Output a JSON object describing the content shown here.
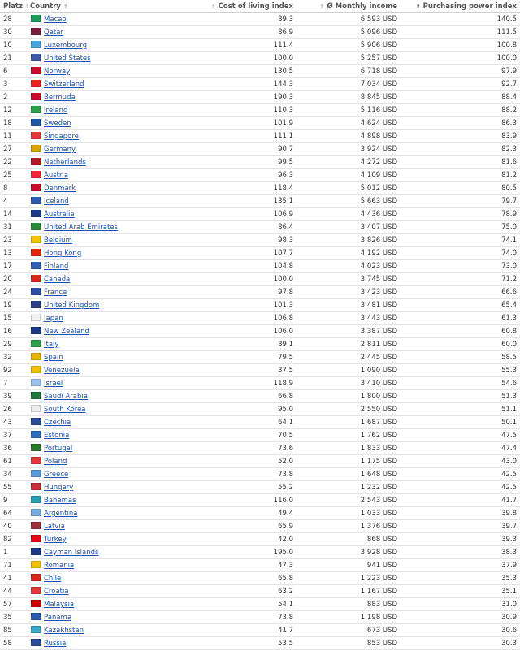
{
  "headers": {
    "rank": "Platz",
    "country": "Country",
    "cost": "Cost of living index",
    "income": "Ø Monthly income",
    "ppi": "Purchasing power index",
    "sort_icon": "⇕",
    "sort_active_icon": "⬍"
  },
  "rows": [
    {
      "rank": "28",
      "country": "Macao",
      "cost": "89.3",
      "income": "6,593 USD",
      "ppi": "140.5",
      "flag": "#1f9a5a"
    },
    {
      "rank": "30",
      "country": "Qatar",
      "cost": "86.9",
      "income": "5,096 USD",
      "ppi": "111.5",
      "flag": "#7b1e3a"
    },
    {
      "rank": "10",
      "country": "Luxembourg",
      "cost": "111.4",
      "income": "5,906 USD",
      "ppi": "100.8",
      "flag": "#4aa3df"
    },
    {
      "rank": "21",
      "country": "United States",
      "cost": "100.0",
      "income": "5,257 USD",
      "ppi": "100.0",
      "flag": "#3c5aa6"
    },
    {
      "rank": "6",
      "country": "Norway",
      "cost": "130.5",
      "income": "6,718 USD",
      "ppi": "97.9",
      "flag": "#c8102e"
    },
    {
      "rank": "3",
      "country": "Switzerland",
      "cost": "144.3",
      "income": "7,034 USD",
      "ppi": "92.7",
      "flag": "#e52521"
    },
    {
      "rank": "2",
      "country": "Bermuda",
      "cost": "190.3",
      "income": "8,845 USD",
      "ppi": "88.4",
      "flag": "#c8102e"
    },
    {
      "rank": "12",
      "country": "Ireland",
      "cost": "110.3",
      "income": "5,116 USD",
      "ppi": "88.2",
      "flag": "#2aa04a"
    },
    {
      "rank": "18",
      "country": "Sweden",
      "cost": "101.9",
      "income": "4,624 USD",
      "ppi": "86.3",
      "flag": "#1d5aa6"
    },
    {
      "rank": "11",
      "country": "Singapore",
      "cost": "111.1",
      "income": "4,898 USD",
      "ppi": "83.9",
      "flag": "#e03a3e"
    },
    {
      "rank": "27",
      "country": "Germany",
      "cost": "90.7",
      "income": "3,924 USD",
      "ppi": "82.3",
      "flag": "#d9a400"
    },
    {
      "rank": "22",
      "country": "Netherlands",
      "cost": "99.5",
      "income": "4,272 USD",
      "ppi": "81.6",
      "flag": "#ae1c28"
    },
    {
      "rank": "25",
      "country": "Austria",
      "cost": "96.3",
      "income": "4,109 USD",
      "ppi": "81.2",
      "flag": "#ed2939"
    },
    {
      "rank": "8",
      "country": "Denmark",
      "cost": "118.4",
      "income": "5,012 USD",
      "ppi": "80.5",
      "flag": "#c8102e"
    },
    {
      "rank": "4",
      "country": "Iceland",
      "cost": "135.1",
      "income": "5,663 USD",
      "ppi": "79.7",
      "flag": "#2a5db0"
    },
    {
      "rank": "14",
      "country": "Australia",
      "cost": "106.9",
      "income": "4,436 USD",
      "ppi": "78.9",
      "flag": "#1b3a8a"
    },
    {
      "rank": "31",
      "country": "United Arab Emirates",
      "cost": "86.4",
      "income": "3,407 USD",
      "ppi": "75.0",
      "flag": "#2a8a3a"
    },
    {
      "rank": "23",
      "country": "Belgium",
      "cost": "98.3",
      "income": "3,826 USD",
      "ppi": "74.1",
      "flag": "#f5c400"
    },
    {
      "rank": "13",
      "country": "Hong Kong",
      "cost": "107.7",
      "income": "4,192 USD",
      "ppi": "74.0",
      "flag": "#de2910"
    },
    {
      "rank": "17",
      "country": "Finland",
      "cost": "104.8",
      "income": "4,023 USD",
      "ppi": "73.0",
      "flag": "#2f5fb3"
    },
    {
      "rank": "20",
      "country": "Canada",
      "cost": "100.0",
      "income": "3,745 USD",
      "ppi": "71.2",
      "flag": "#d52b1e"
    },
    {
      "rank": "24",
      "country": "France",
      "cost": "97.8",
      "income": "3,423 USD",
      "ppi": "66.6",
      "flag": "#2b4fa3"
    },
    {
      "rank": "19",
      "country": "United Kingdom",
      "cost": "101.3",
      "income": "3,481 USD",
      "ppi": "65.4",
      "flag": "#2a3f86"
    },
    {
      "rank": "15",
      "country": "Japan",
      "cost": "106.8",
      "income": "3,443 USD",
      "ppi": "61.3",
      "flag": "#f2f2f2"
    },
    {
      "rank": "16",
      "country": "New Zealand",
      "cost": "106.0",
      "income": "3,387 USD",
      "ppi": "60.8",
      "flag": "#1b3a8a"
    },
    {
      "rank": "29",
      "country": "Italy",
      "cost": "89.1",
      "income": "2,811 USD",
      "ppi": "60.0",
      "flag": "#2aa04a"
    },
    {
      "rank": "32",
      "country": "Spain",
      "cost": "79.5",
      "income": "2,445 USD",
      "ppi": "58.5",
      "flag": "#e8b400"
    },
    {
      "rank": "92",
      "country": "Venezuela",
      "cost": "37.5",
      "income": "1,090 USD",
      "ppi": "55.3",
      "flag": "#f2c200"
    },
    {
      "rank": "7",
      "country": "Israel",
      "cost": "118.9",
      "income": "3,410 USD",
      "ppi": "54.6",
      "flag": "#9ac4ef"
    },
    {
      "rank": "39",
      "country": "Saudi Arabia",
      "cost": "66.8",
      "income": "1,800 USD",
      "ppi": "51.3",
      "flag": "#1c7a3a"
    },
    {
      "rank": "26",
      "country": "South Korea",
      "cost": "95.0",
      "income": "2,550 USD",
      "ppi": "51.1",
      "flag": "#eeeeee"
    },
    {
      "rank": "43",
      "country": "Czechia",
      "cost": "64.1",
      "income": "1,687 USD",
      "ppi": "50.1",
      "flag": "#2a4f9a"
    },
    {
      "rank": "37",
      "country": "Estonia",
      "cost": "70.5",
      "income": "1,762 USD",
      "ppi": "47.5",
      "flag": "#2a6fc2"
    },
    {
      "rank": "36",
      "country": "Portugal",
      "cost": "73.6",
      "income": "1,833 USD",
      "ppi": "47.4",
      "flag": "#2a7a2a"
    },
    {
      "rank": "61",
      "country": "Poland",
      "cost": "52.0",
      "income": "1,175 USD",
      "ppi": "43.0",
      "flag": "#e03a3e"
    },
    {
      "rank": "34",
      "country": "Greece",
      "cost": "73.8",
      "income": "1,648 USD",
      "ppi": "42.5",
      "flag": "#5a9be0"
    },
    {
      "rank": "55",
      "country": "Hungary",
      "cost": "55.2",
      "income": "1,232 USD",
      "ppi": "42.5",
      "flag": "#c8313a"
    },
    {
      "rank": "9",
      "country": "Bahamas",
      "cost": "116.0",
      "income": "2,543 USD",
      "ppi": "41.7",
      "flag": "#26a0b0"
    },
    {
      "rank": "64",
      "country": "Argentina",
      "cost": "49.4",
      "income": "1,033 USD",
      "ppi": "39.8",
      "flag": "#74acdf"
    },
    {
      "rank": "40",
      "country": "Latvia",
      "cost": "65.9",
      "income": "1,376 USD",
      "ppi": "39.7",
      "flag": "#9e3039"
    },
    {
      "rank": "82",
      "country": "Turkey",
      "cost": "42.0",
      "income": "868 USD",
      "ppi": "39.3",
      "flag": "#e30a17"
    },
    {
      "rank": "1",
      "country": "Cayman Islands",
      "cost": "195.0",
      "income": "3,928 USD",
      "ppi": "38.3",
      "flag": "#1b3a8a"
    },
    {
      "rank": "71",
      "country": "Romania",
      "cost": "47.3",
      "income": "941 USD",
      "ppi": "37.9",
      "flag": "#f2c200"
    },
    {
      "rank": "41",
      "country": "Chile",
      "cost": "65.8",
      "income": "1,223 USD",
      "ppi": "35.3",
      "flag": "#d52b1e"
    },
    {
      "rank": "44",
      "country": "Croatia",
      "cost": "63.2",
      "income": "1,167 USD",
      "ppi": "35.1",
      "flag": "#e03a3e"
    },
    {
      "rank": "57",
      "country": "Malaysia",
      "cost": "54.1",
      "income": "883 USD",
      "ppi": "31.0",
      "flag": "#cc0001"
    },
    {
      "rank": "35",
      "country": "Panama",
      "cost": "73.8",
      "income": "1,198 USD",
      "ppi": "30.9",
      "flag": "#2a5db0"
    },
    {
      "rank": "85",
      "country": "Kazakhstan",
      "cost": "41.7",
      "income": "673 USD",
      "ppi": "30.6",
      "flag": "#3aa9c9"
    },
    {
      "rank": "58",
      "country": "Russia",
      "cost": "53.5",
      "income": "853 USD",
      "ppi": "30.3",
      "flag": "#2a4f9a"
    }
  ]
}
